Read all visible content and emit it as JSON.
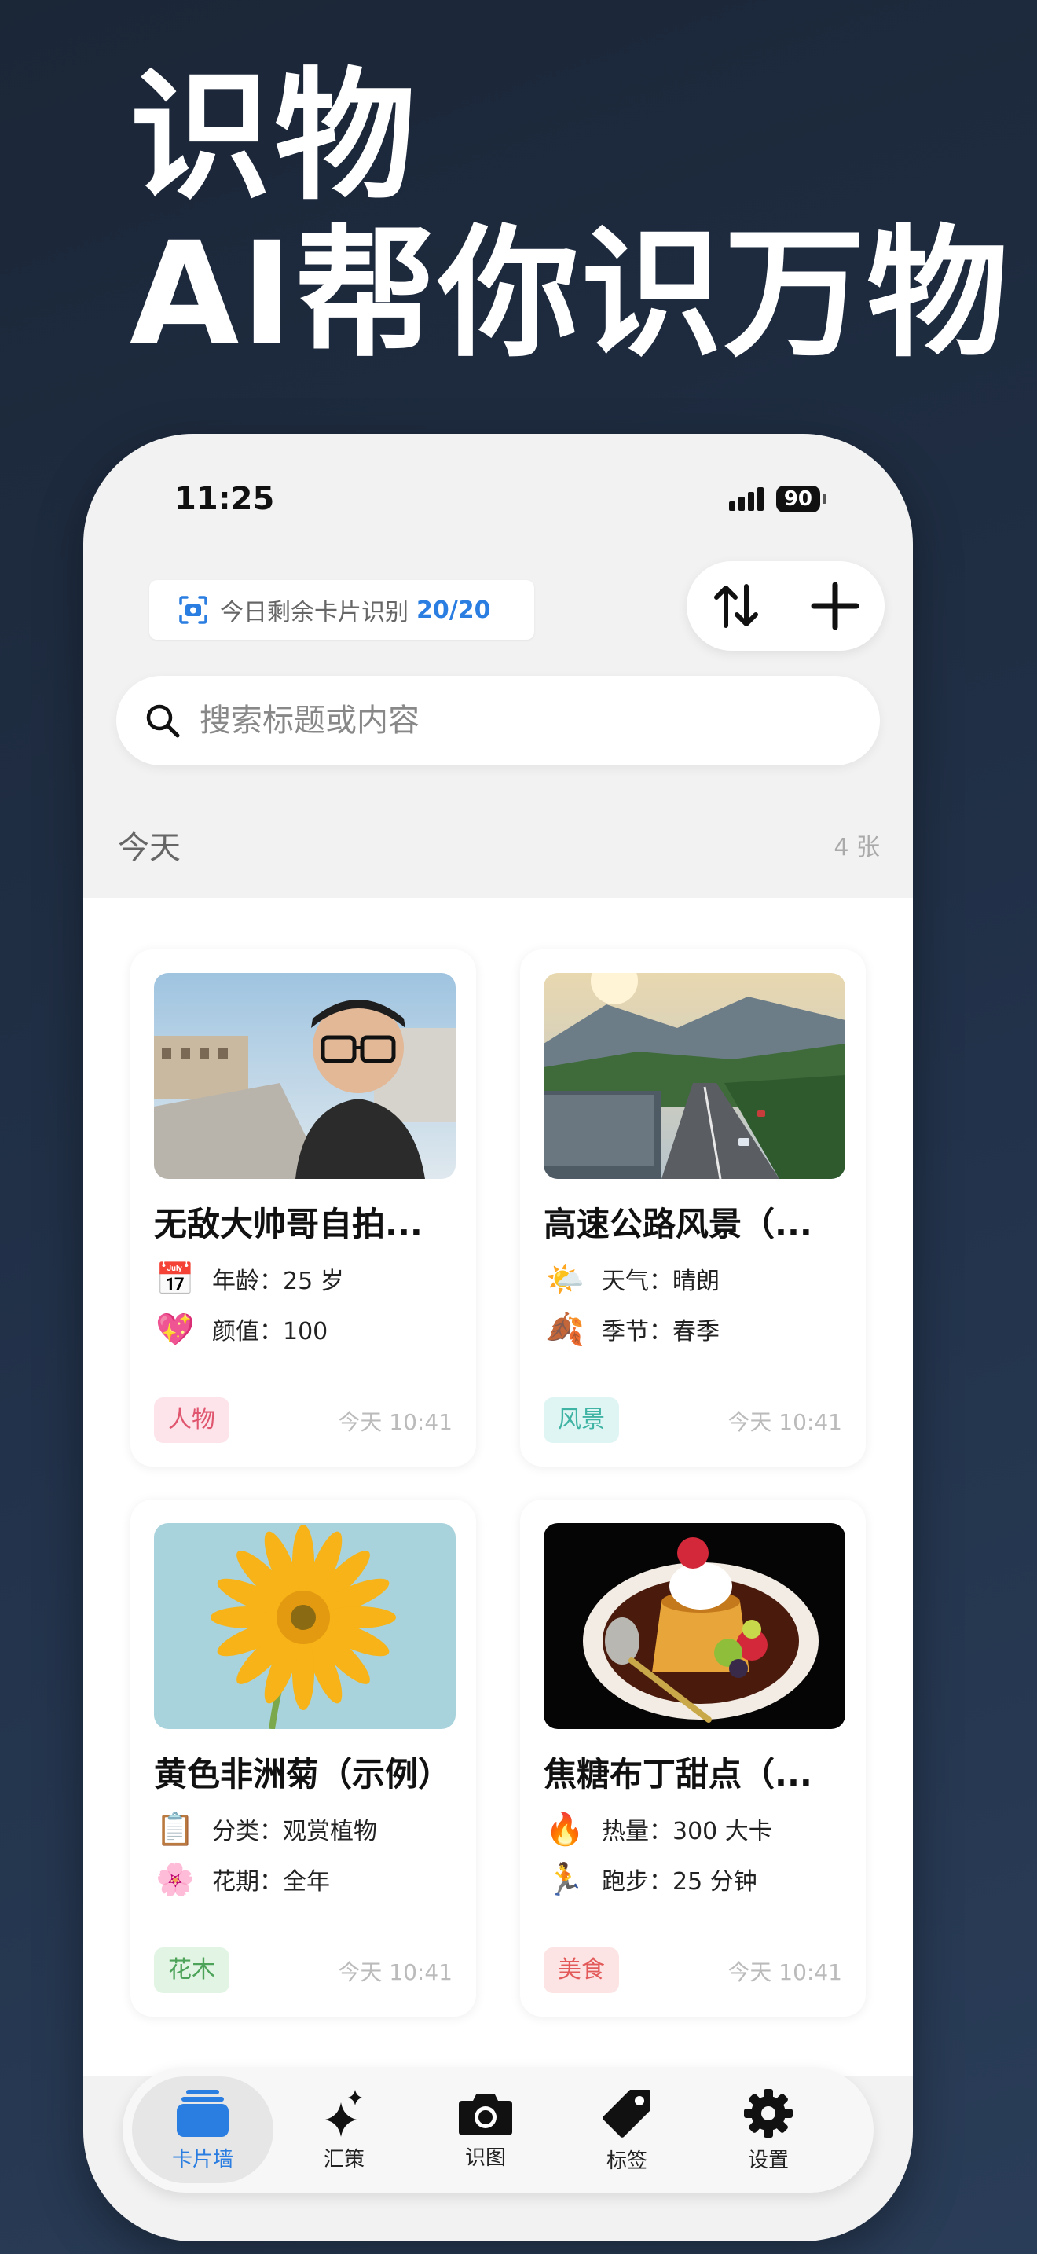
{
  "headline": {
    "line1": "识物",
    "line2": "AI帮你识万物"
  },
  "status_bar": {
    "time": "11:25",
    "battery": "90"
  },
  "quota": {
    "label": "今日剩余卡片识别",
    "count": "20/20"
  },
  "search": {
    "placeholder": "搜索标题或内容"
  },
  "section": {
    "title": "今天",
    "count": "4 张"
  },
  "cards": [
    {
      "title": "无敌大帅哥自拍...",
      "attrs": [
        {
          "emoji": "📅",
          "text": "年龄：25 岁"
        },
        {
          "emoji": "💖",
          "text": "颜值：100"
        }
      ],
      "tag": "人物",
      "time": "今天 10:41"
    },
    {
      "title": "高速公路风景（...",
      "attrs": [
        {
          "emoji": "🌤️",
          "text": "天气：晴朗"
        },
        {
          "emoji": "🍂",
          "text": "季节：春季"
        }
      ],
      "tag": "风景",
      "time": "今天 10:41"
    },
    {
      "title": "黄色非洲菊（示例）",
      "attrs": [
        {
          "emoji": "📋",
          "text": "分类：观赏植物"
        },
        {
          "emoji": "🌸",
          "text": "花期：全年"
        }
      ],
      "tag": "花木",
      "time": "今天 10:41"
    },
    {
      "title": "焦糖布丁甜点（...",
      "attrs": [
        {
          "emoji": "🔥",
          "text": "热量：300 大卡"
        },
        {
          "emoji": "🏃",
          "text": "跑步：25 分钟"
        }
      ],
      "tag": "美食",
      "time": "今天 10:41"
    }
  ],
  "tabs": [
    {
      "label": "卡片墙",
      "icon": "cards-icon",
      "active": true
    },
    {
      "label": "汇策",
      "icon": "sparkle-icon"
    },
    {
      "label": "识图",
      "icon": "camera-icon"
    },
    {
      "label": "标签",
      "icon": "tag-icon"
    },
    {
      "label": "设置",
      "icon": "gear-icon"
    }
  ],
  "colors": {
    "accent": "#2a7de1",
    "background": "#1f2c41"
  }
}
